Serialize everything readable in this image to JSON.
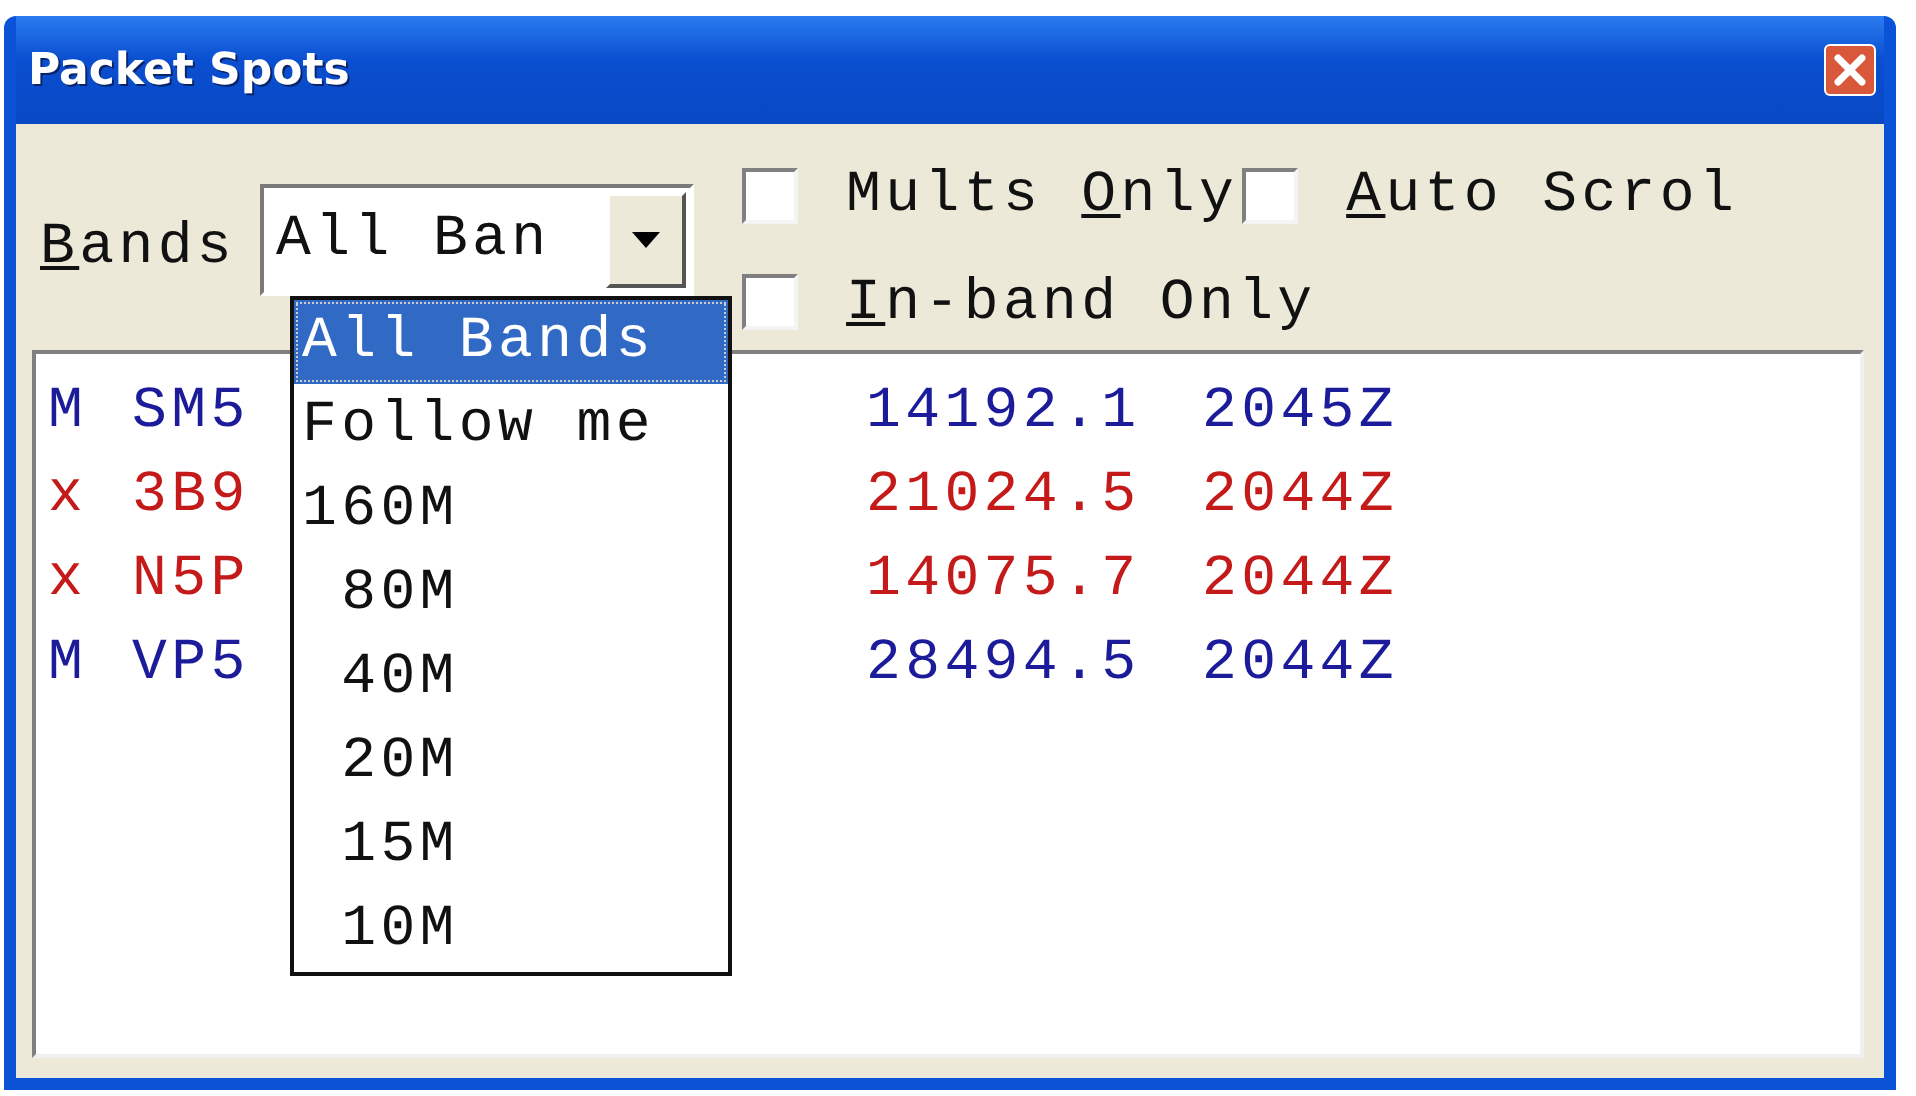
{
  "window": {
    "title": "Packet Spots"
  },
  "bands": {
    "label": {
      "accel": "B",
      "after": "ands"
    },
    "value": "All Ban",
    "expanded": true,
    "options": [
      {
        "label": "All Bands",
        "selected": true
      },
      {
        "label": "Follow me",
        "selected": false
      },
      {
        "label": "160M",
        "selected": false
      },
      {
        "label": " 80M",
        "selected": false
      },
      {
        "label": " 40M",
        "selected": false
      },
      {
        "label": " 20M",
        "selected": false
      },
      {
        "label": " 15M",
        "selected": false
      },
      {
        "label": " 10M",
        "selected": false
      }
    ]
  },
  "checkboxes": [
    {
      "before": "Mults ",
      "accel": "O",
      "after": "nly",
      "checked": false
    },
    {
      "accel": "A",
      "after": "uto Scrol",
      "checked": false
    },
    {
      "accel": "I",
      "after": "n-band Only",
      "checked": false
    }
  ],
  "spots": [
    {
      "flag": "M",
      "call": "SM5",
      "freq": "14192.1",
      "time": "2045Z",
      "color": "#1c1c9a"
    },
    {
      "flag": "x",
      "call": "3B9",
      "freq": "21024.5",
      "time": "2044Z",
      "color": "#c41a1a"
    },
    {
      "flag": "x",
      "call": "N5P",
      "freq": "14075.7",
      "time": "2044Z",
      "color": "#c41a1a"
    },
    {
      "flag": "M",
      "call": "VP5",
      "freq": "28494.5",
      "time": "2044Z",
      "color": "#1c1c9a"
    }
  ]
}
